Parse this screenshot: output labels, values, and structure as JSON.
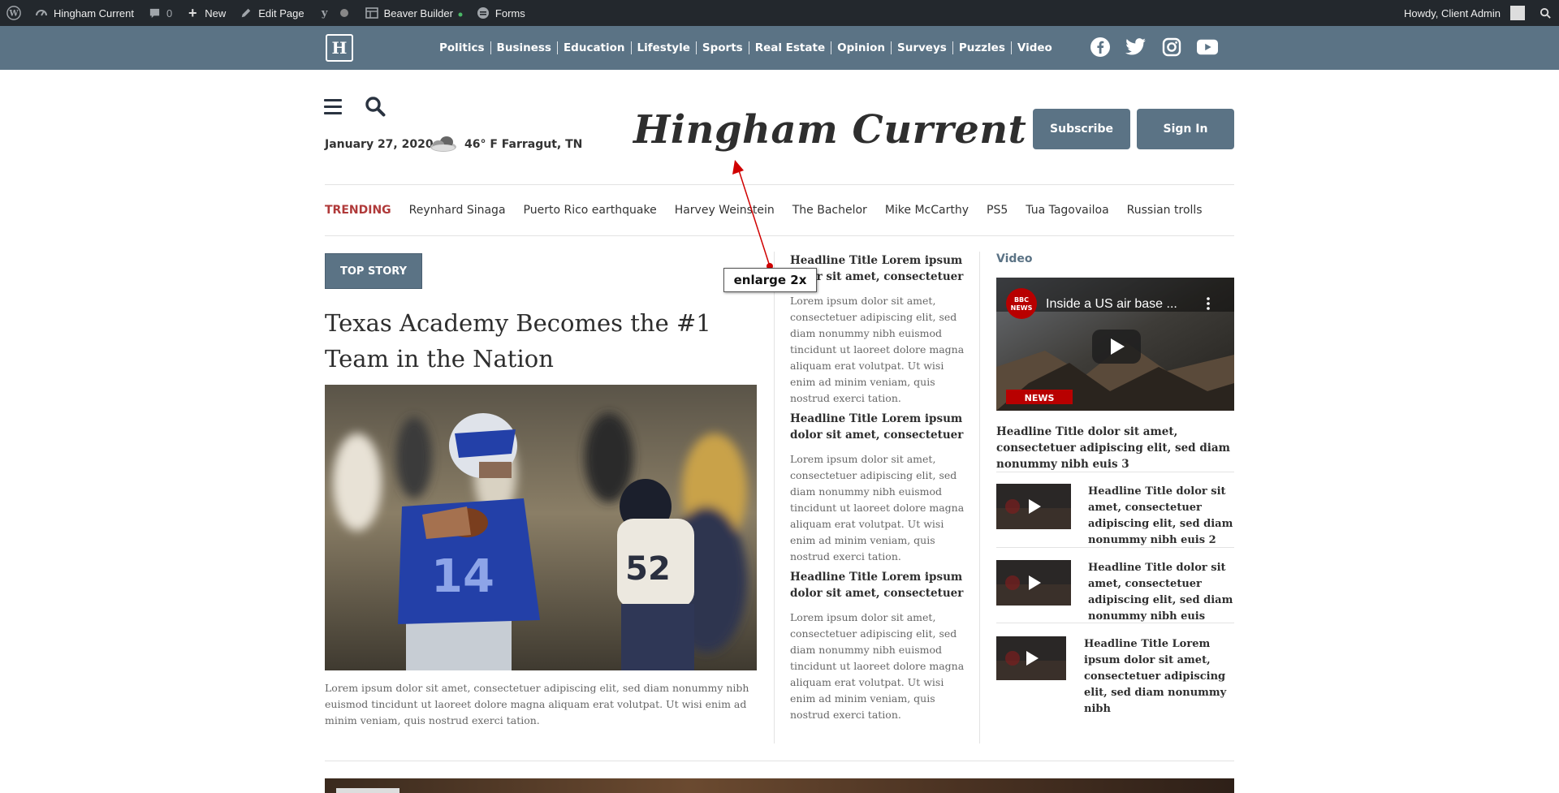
{
  "adminbar": {
    "site": "Hingham Current",
    "comments": "0",
    "new": "New",
    "edit_page": "Edit Page",
    "beaver": "Beaver Builder",
    "forms": "Forms",
    "howdy": "Howdy, Client Admin"
  },
  "nav": {
    "logo_letter": "H",
    "links": [
      "Politics",
      "Business",
      "Education",
      "Lifestyle",
      "Sports",
      "Real Estate",
      "Opinion",
      "Surveys",
      "Puzzles",
      "Video"
    ]
  },
  "header": {
    "date": "January 27, 2020",
    "weather": "46° F Farragut, TN",
    "masthead": "Hingham Current",
    "subscribe": "Subscribe",
    "sign_in": "Sign In"
  },
  "trending": {
    "label": "TRENDING",
    "items": [
      "Reynhard Sinaga",
      "Puerto Rico earthquake",
      "Harvey Weinstein",
      "The Bachelor",
      "Mike McCarthy",
      "PS5",
      "Tua Tagovailoa",
      "Russian trolls"
    ]
  },
  "top_story": {
    "badge": "TOP STORY",
    "title": "Texas Academy Becomes the #1 Team in the Nation",
    "caption": "Lorem ipsum dolor sit amet, consectetuer adipiscing elit, sed diam nonummy nibh euismod tincidunt ut laoreet dolore magna aliquam erat volutpat. Ut wisi enim ad minim veniam, quis nostrud exerci tation.",
    "jersey": "14"
  },
  "middle": [
    {
      "head": "Headline Title Lorem ipsum dolor sit amet, consectetuer",
      "body": "Lorem ipsum dolor sit amet, consectetuer adipiscing elit, sed diam nonummy nibh euismod tincidunt ut laoreet dolore magna aliquam erat volutpat. Ut wisi enim ad minim veniam, quis nostrud exerci tation."
    },
    {
      "head": "Headline Title Lorem ipsum dolor sit amet, consectetuer",
      "body": "Lorem ipsum dolor sit amet, consectetuer adipiscing elit, sed diam nonummy nibh euismod tincidunt ut laoreet dolore magna aliquam erat volutpat. Ut wisi enim ad minim veniam, quis nostrud exerci tation."
    },
    {
      "head": "Headline Title Lorem ipsum dolor sit amet, consectetuer",
      "body": "Lorem ipsum dolor sit amet, consectetuer adipiscing elit, sed diam nonummy nibh euismod tincidunt ut laoreet dolore magna aliquam erat volutpat. Ut wisi enim ad minim veniam, quis nostrud exerci tation."
    }
  ],
  "video": {
    "label": "Video",
    "main_video_title": "Inside a US air base ...",
    "bbc": "BBC",
    "bbc_news": "NEWS",
    "main_title": "Headline Title dolor sit amet, consectetuer adipiscing elit, sed diam nonummy nibh euis 3",
    "items": [
      {
        "title": "Headline Title dolor sit amet, consectetuer adipiscing elit, sed diam nonummy nibh euis 2"
      },
      {
        "title": "Headline Title dolor sit amet, consectetuer adipiscing elit, sed diam nonummy nibh euis"
      },
      {
        "title": "Headline Title Lorem ipsum dolor sit amet, consectetuer adipiscing elit, sed diam nonummy nibh"
      }
    ]
  },
  "annotation": {
    "label": "enlarge 2x"
  },
  "colors": {
    "nav_bg": "#5b7385",
    "admin_bg": "#23282d",
    "trending": "#b03a3a",
    "annotation": "#d00000"
  }
}
